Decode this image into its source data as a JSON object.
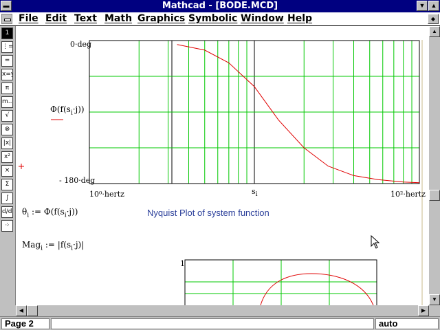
{
  "window": {
    "title": "Mathcad - [BODE.MCD]"
  },
  "menu": [
    "File",
    "Edit",
    "Text",
    "Math",
    "Graphics",
    "Symbolic",
    "Window",
    "Help"
  ],
  "palette": {
    "buttons": [
      {
        "name": "palette-button-1",
        "glyph": "1"
      },
      {
        "name": "palette-button-range",
        "glyph": "⋮="
      },
      {
        "name": "palette-button-equals",
        "glyph": "="
      },
      {
        "name": "palette-button-xy",
        "glyph": "x=y"
      },
      {
        "name": "palette-button-pi",
        "glyph": "π"
      },
      {
        "name": "palette-button-range-var",
        "glyph": "m..n"
      },
      {
        "name": "palette-button-sqrt",
        "glyph": "√"
      },
      {
        "name": "palette-button-times",
        "glyph": "⊗"
      },
      {
        "name": "palette-button-abs",
        "glyph": "|x|"
      },
      {
        "name": "palette-button-power",
        "glyph": "x²"
      },
      {
        "name": "palette-button-cross",
        "glyph": "×"
      },
      {
        "name": "palette-button-sum",
        "glyph": "Σ"
      },
      {
        "name": "palette-button-integral",
        "glyph": "∫"
      },
      {
        "name": "palette-button-derivative",
        "glyph": "d/dx"
      },
      {
        "name": "palette-button-limit",
        "glyph": "⁘"
      }
    ]
  },
  "bode_plot": {
    "y_top_label": "0·deg",
    "y_bottom_label": "- 180·deg",
    "x_left_label": "10⁰·hertz",
    "x_right_label": "10²·hertz",
    "x_var": "s",
    "x_var_sub": "i",
    "y_expr": "Φ(f(s",
    "y_expr_sub": "i",
    "y_expr_tail": "·j))"
  },
  "chart_data": [
    {
      "type": "line",
      "x_scale": "log",
      "xlim": [
        1,
        100
      ],
      "ylim": [
        -180,
        0
      ],
      "x_ticks": [
        "10⁰·hertz",
        "10²·hertz"
      ],
      "y_ticks": [
        "0·deg",
        "- 180·deg"
      ],
      "grid": true,
      "x": [
        3.4,
        5,
        7,
        10,
        14,
        20,
        28,
        40,
        56,
        80,
        100
      ],
      "y": [
        -5,
        -12,
        -28,
        -58,
        -100,
        -135,
        -158,
        -170,
        -175,
        -178,
        -179
      ]
    },
    {
      "type": "line",
      "ylim": [
        0,
        1
      ],
      "y_ticks": [
        "1"
      ],
      "grid": true
    }
  ],
  "equations": {
    "theta_lhs": "θ",
    "theta_sub": "i",
    "theta_rhs_a": "Φ(f(s",
    "theta_rhs_sub": "i",
    "theta_rhs_b": "·j))",
    "assign": ":=",
    "mag_lhs": "Mag",
    "mag_sub": "i",
    "mag_rhs_a": "|f(s",
    "mag_rhs_sub": "i",
    "mag_rhs_b": "·j)|"
  },
  "note_text": "Nyquist Plot of system function",
  "nyquist": {
    "y_top_label": "1"
  },
  "status": {
    "page": "Page 2",
    "mode": "auto"
  },
  "colors": {
    "grid": "#00c800",
    "curve": "#e00000",
    "title_bar": "#000080",
    "note": "#2b3f9a"
  }
}
